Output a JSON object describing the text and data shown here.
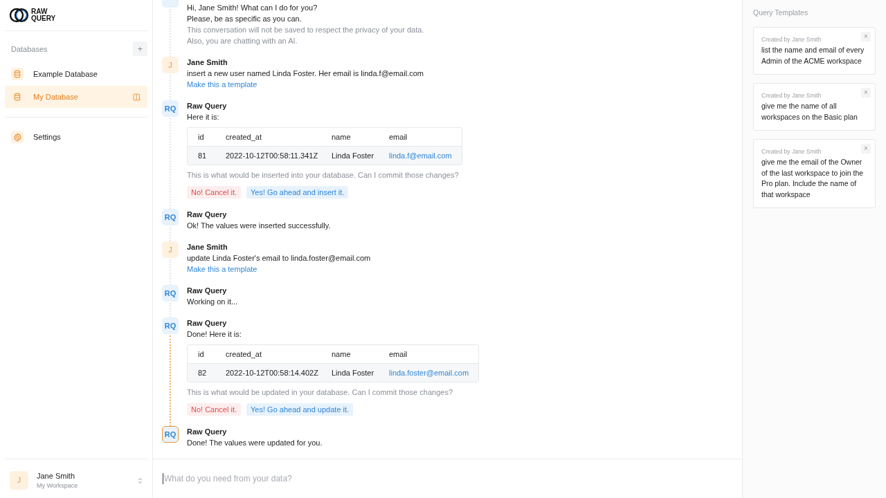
{
  "sidebar": {
    "logo": {
      "line1": "RAW",
      "line2": "QUERY"
    },
    "section_title": "Databases",
    "add_button": "+",
    "databases": [
      {
        "name": "Example Database",
        "selected": false
      },
      {
        "name": "My Database",
        "selected": true
      }
    ],
    "settings": "Settings",
    "user": {
      "initial": "J",
      "name": "Jane Smith",
      "workspace": "My Workspace"
    }
  },
  "chat": {
    "messages": [
      {
        "kind": "bot",
        "active": false,
        "blocks": [
          {
            "kind": "text",
            "text": "Hi, Jane Smith! What can I do for you?"
          },
          {
            "kind": "text",
            "text": "Please, be as specific as you can."
          },
          {
            "kind": "muted",
            "text": "This conversation will not be saved to respect the privacy of your data."
          },
          {
            "kind": "muted",
            "text": "Also, you are chatting with an AI."
          }
        ]
      },
      {
        "kind": "user",
        "avatar": "J",
        "author": "Jane Smith",
        "active": false,
        "blocks": [
          {
            "kind": "text",
            "text": "insert a new user named Linda Foster. Her email is linda.f@email.com"
          },
          {
            "kind": "link",
            "text": "Make this a template"
          }
        ]
      },
      {
        "kind": "bot",
        "avatar": "RQ",
        "author": "Raw Query",
        "active": false,
        "blocks": [
          {
            "kind": "text",
            "text": "Here it is:"
          },
          {
            "kind": "table",
            "columns": [
              "id",
              "created_at",
              "name",
              "email"
            ],
            "rows": [
              [
                "81",
                "2022-10-12T00:58:11.341Z",
                "Linda Foster",
                "linda.f@email.com"
              ]
            ]
          },
          {
            "kind": "muted",
            "text": "This is what would be inserted into your database. Can I commit those changes?"
          },
          {
            "kind": "actions",
            "cancel": "No! Cancel it.",
            "confirm": "Yes! Go ahead and insert it."
          }
        ]
      },
      {
        "kind": "bot",
        "avatar": "RQ",
        "author": "Raw Query",
        "active": false,
        "blocks": [
          {
            "kind": "text",
            "text": "Ok! The values were inserted successfully."
          }
        ]
      },
      {
        "kind": "user",
        "avatar": "J",
        "author": "Jane Smith",
        "active": false,
        "blocks": [
          {
            "kind": "text",
            "text": "update Linda Foster's email to linda.foster@email.com"
          },
          {
            "kind": "link",
            "text": "Make this a template"
          }
        ]
      },
      {
        "kind": "bot",
        "avatar": "RQ",
        "author": "Raw Query",
        "active": false,
        "blocks": [
          {
            "kind": "text",
            "text": "Working on it..."
          }
        ]
      },
      {
        "kind": "bot",
        "avatar": "RQ",
        "author": "Raw Query",
        "active": false,
        "blocks": [
          {
            "kind": "text",
            "text": "Done! Here it is:"
          },
          {
            "kind": "table",
            "columns": [
              "id",
              "created_at",
              "name",
              "email"
            ],
            "rows": [
              [
                "82",
                "2022-10-12T00:58:14.402Z",
                "Linda Foster",
                "linda.foster@email.com"
              ]
            ]
          },
          {
            "kind": "muted",
            "text": "This is what would be updated in your database. Can I commit those changes?"
          },
          {
            "kind": "actions",
            "cancel": "No! Cancel it.",
            "confirm": "Yes! Go ahead and update it."
          }
        ]
      },
      {
        "kind": "bot",
        "avatar": "RQ",
        "author": "Raw Query",
        "active": true,
        "blocks": [
          {
            "kind": "text",
            "text": "Done! The values were updated for you."
          }
        ]
      }
    ],
    "input": {
      "placeholder": "What do you need from your data?"
    }
  },
  "templates": {
    "title": "Query Templates",
    "items": [
      {
        "created_by": "Created by Jane Smith",
        "text": "list the name and email of every Admin of the ACME workspace",
        "close": "×"
      },
      {
        "created_by": "Created by Jane Smith",
        "text": "give me the name of all workspaces on the Basic plan",
        "close": "×"
      },
      {
        "created_by": "Created by Jane Smith",
        "text": "give me the email of the Owner of the last workspace to join the Pro plan. Include the name of that workspace",
        "close": "×"
      }
    ]
  }
}
